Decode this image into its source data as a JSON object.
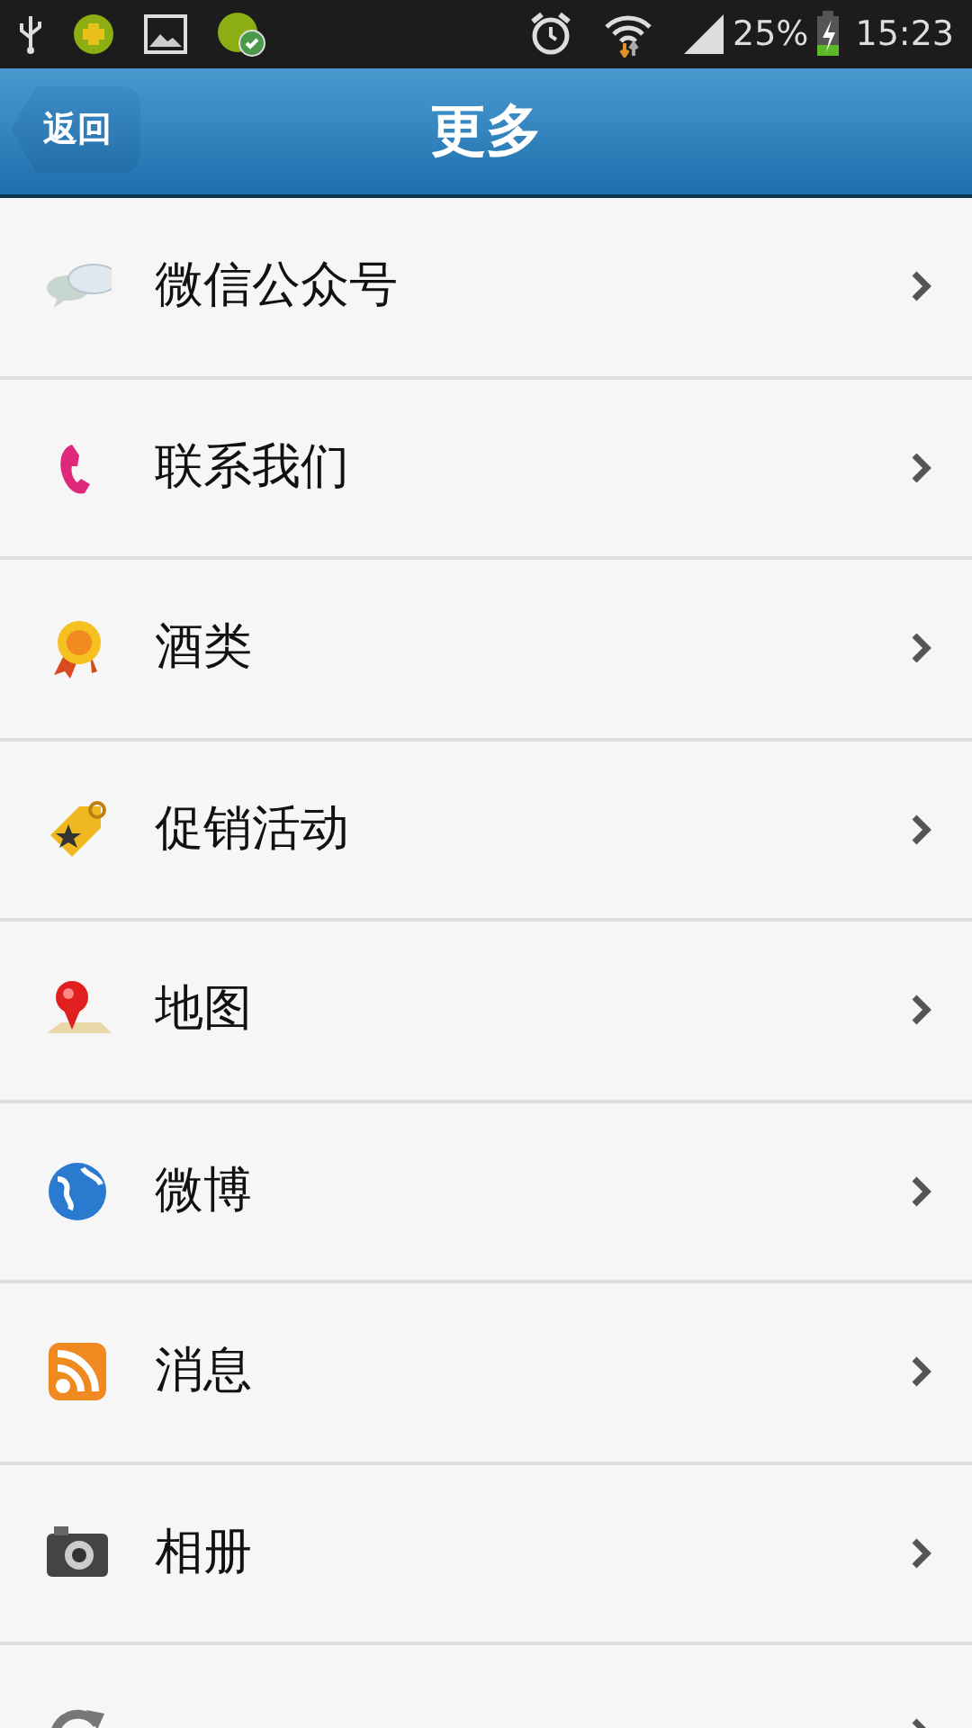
{
  "status_bar": {
    "battery": "25%",
    "time": "15:23"
  },
  "header": {
    "back": "返回",
    "title": "更多"
  },
  "items": [
    {
      "label": "微信公众号"
    },
    {
      "label": "联系我们"
    },
    {
      "label": "酒类"
    },
    {
      "label": "促销活动"
    },
    {
      "label": "地图"
    },
    {
      "label": "微博"
    },
    {
      "label": "消息"
    },
    {
      "label": "相册"
    }
  ],
  "cut_off_row": true
}
